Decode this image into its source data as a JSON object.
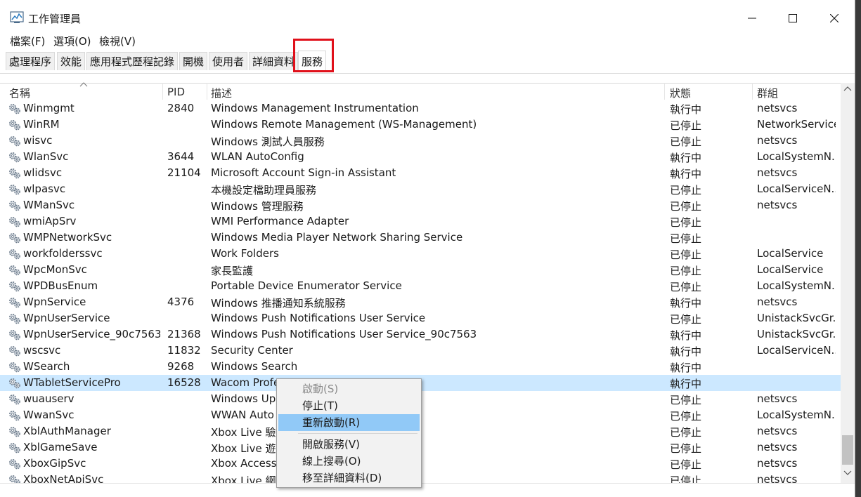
{
  "window": {
    "title": "工作管理員"
  },
  "menu": [
    "檔案(F)",
    "選項(O)",
    "檢視(V)"
  ],
  "tabs": [
    "處理程序",
    "效能",
    "應用程式歷程記錄",
    "開機",
    "使用者",
    "詳細資料",
    "服務"
  ],
  "active_tab": "服務",
  "columns": {
    "name": "名稱",
    "pid": "PID",
    "desc": "描述",
    "status": "狀態",
    "group": "群組"
  },
  "rows": [
    {
      "name": "Winmgmt",
      "pid": "2840",
      "desc": "Windows Management Instrumentation",
      "status": "執行中",
      "group": "netsvcs"
    },
    {
      "name": "WinRM",
      "pid": "",
      "desc": "Windows Remote Management (WS-Management)",
      "status": "已停止",
      "group": "NetworkService"
    },
    {
      "name": "wisvc",
      "pid": "",
      "desc": "Windows 測試人員服務",
      "status": "已停止",
      "group": "netsvcs"
    },
    {
      "name": "WlanSvc",
      "pid": "3644",
      "desc": "WLAN AutoConfig",
      "status": "執行中",
      "group": "LocalSystemN..."
    },
    {
      "name": "wlidsvc",
      "pid": "21104",
      "desc": "Microsoft Account Sign-in Assistant",
      "status": "執行中",
      "group": "netsvcs"
    },
    {
      "name": "wlpasvc",
      "pid": "",
      "desc": "本機設定檔助理員服務",
      "status": "已停止",
      "group": "LocalServiceN..."
    },
    {
      "name": "WManSvc",
      "pid": "",
      "desc": "Windows 管理服務",
      "status": "已停止",
      "group": "netsvcs"
    },
    {
      "name": "wmiApSrv",
      "pid": "",
      "desc": "WMI Performance Adapter",
      "status": "已停止",
      "group": ""
    },
    {
      "name": "WMPNetworkSvc",
      "pid": "",
      "desc": "Windows Media Player Network Sharing Service",
      "status": "已停止",
      "group": ""
    },
    {
      "name": "workfolderssvc",
      "pid": "",
      "desc": "Work Folders",
      "status": "已停止",
      "group": "LocalService"
    },
    {
      "name": "WpcMonSvc",
      "pid": "",
      "desc": "家長監護",
      "status": "已停止",
      "group": "LocalService"
    },
    {
      "name": "WPDBusEnum",
      "pid": "",
      "desc": "Portable Device Enumerator Service",
      "status": "已停止",
      "group": "LocalSystemN..."
    },
    {
      "name": "WpnService",
      "pid": "4376",
      "desc": "Windows 推播通知系統服務",
      "status": "執行中",
      "group": "netsvcs"
    },
    {
      "name": "WpnUserService",
      "pid": "",
      "desc": "Windows Push Notifications User Service",
      "status": "已停止",
      "group": "UnistackSvcGr..."
    },
    {
      "name": "WpnUserService_90c7563",
      "pid": "21368",
      "desc": "Windows Push Notifications User Service_90c7563",
      "status": "執行中",
      "group": "UnistackSvcGr..."
    },
    {
      "name": "wscsvc",
      "pid": "11832",
      "desc": "Security Center",
      "status": "執行中",
      "group": "LocalServiceN..."
    },
    {
      "name": "WSearch",
      "pid": "9268",
      "desc": "Windows Search",
      "status": "執行中",
      "group": ""
    },
    {
      "name": "WTabletServicePro",
      "pid": "16528",
      "desc": "Wacom Profe",
      "status": "執行中",
      "group": "",
      "selected": true
    },
    {
      "name": "wuauserv",
      "pid": "",
      "desc": "Windows Up",
      "status": "已停止",
      "group": "netsvcs"
    },
    {
      "name": "WwanSvc",
      "pid": "",
      "desc": "WWAN Auto",
      "status": "已停止",
      "group": "LocalSystemN..."
    },
    {
      "name": "XblAuthManager",
      "pid": "",
      "desc": "Xbox Live 驗證",
      "status": "已停止",
      "group": "netsvcs"
    },
    {
      "name": "XblGameSave",
      "pid": "",
      "desc": "Xbox Live 遊戲",
      "status": "已停止",
      "group": "netsvcs"
    },
    {
      "name": "XboxGipSvc",
      "pid": "",
      "desc": "Xbox Accesso",
      "status": "已停止",
      "group": "netsvcs"
    },
    {
      "name": "XboxNetApiSvc",
      "pid": "",
      "desc": "Xbox Live 網路",
      "status": "已停止",
      "group": "netsvcs"
    }
  ],
  "context_menu": [
    {
      "label": "啟動(S)",
      "disabled": true
    },
    {
      "label": "停止(T)"
    },
    {
      "label": "重新啟動(R)",
      "hover": true
    },
    {
      "label": "開啟服務(V)"
    },
    {
      "label": "線上搜尋(O)"
    },
    {
      "label": "移至詳細資料(D)"
    }
  ],
  "colors": {
    "selected_row": "#cce8ff",
    "menu_hover": "#91c9f7",
    "highlight_box": "#e0101a"
  }
}
